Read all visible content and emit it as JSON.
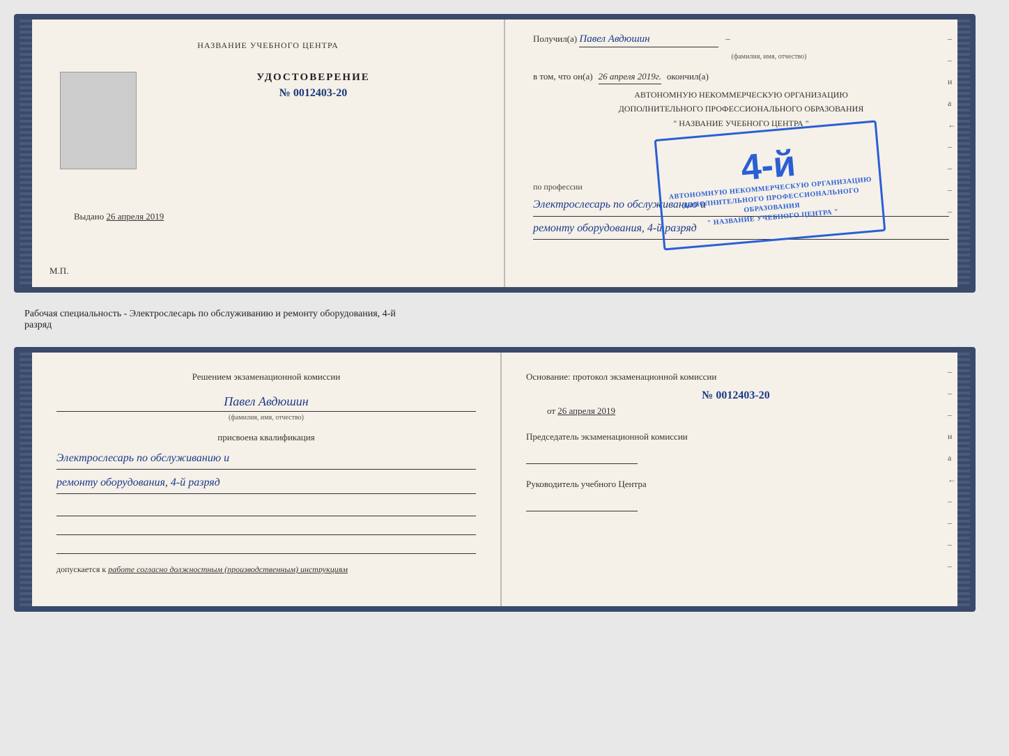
{
  "top_doc": {
    "left": {
      "institution_name": "НАЗВАНИЕ УЧЕБНОГО ЦЕНТРА",
      "doc_type": "УДОСТОВЕРЕНИЕ",
      "doc_number": "№ 0012403-20",
      "photo_alt": "фото",
      "issued_label": "Выдано",
      "issued_date": "26 апреля 2019",
      "mp_label": "М.П."
    },
    "right": {
      "received_label": "Получил(а)",
      "recipient_name": "Павел Авдюшин",
      "fio_hint": "(фамилия, имя, отчество)",
      "vtom_label": "в том, что он(а)",
      "vtom_date": "26 апреля 2019г.",
      "okончил_label": "окончил(а)",
      "org_line1": "АВТОНОМНУЮ НЕКОММЕРЧЕСКУЮ ОРГАНИЗАЦИЮ",
      "org_line2": "ДОПОЛНИТЕЛЬНОГО ПРОФЕССИОНАЛЬНОГО ОБРАЗОВАНИЯ",
      "org_name": "\" НАЗВАНИЕ УЧЕБНОГО ЦЕНТРА \"",
      "profession_label": "по профессии",
      "profession_line1": "Электрослесарь по обслуживанию и",
      "profession_line2": "ремонту оборудования, 4-й разряд"
    },
    "stamp": {
      "rank": "4-й",
      "line1": "АВТОНОМНУЮ НЕКОММЕРЧЕСКУЮ ОРГАНИЗАЦИЮ",
      "line2": "ДОПОЛНИТЕЛЬНОГО ПРОФЕССИОНАЛЬНОГО ОБРАЗОВАНИЯ",
      "line3": "\" НАЗВАНИЕ УЧЕБНОГО ЦЕНТРА \""
    }
  },
  "middle_text": {
    "line1": "Рабочая специальность - Электрослесарь по обслуживанию и ремонту оборудования, 4-й",
    "line2": "разряд"
  },
  "bottom_doc": {
    "left": {
      "komissia_title": "Решением экзаменационной комиссии",
      "name_handwritten": "Павел Авдюшин",
      "fio_hint": "(фамилия, имя, отчество)",
      "prisvoena_label": "присвоена квалификация",
      "qual_line1": "Электрослесарь по обслуживанию и",
      "qual_line2": "ремонту оборудования, 4-й разряд",
      "dopuskaetsya_label": "допускается к",
      "dopuskaetsya_value": "работе согласно должностным (производственным) инструкциям"
    },
    "right": {
      "osnov_label": "Основание: протокол экзаменационной комиссии",
      "protocol_number": "№ 0012403-20",
      "date_ot": "от",
      "date_value": "26 апреля 2019",
      "predsedatel_title": "Председатель экзаменационной комиссии",
      "rukovoditel_title": "Руководитель учебного Центра"
    }
  },
  "right_margin": {
    "items": [
      "и",
      "а",
      "←",
      "–",
      "–",
      "–",
      "–"
    ]
  }
}
